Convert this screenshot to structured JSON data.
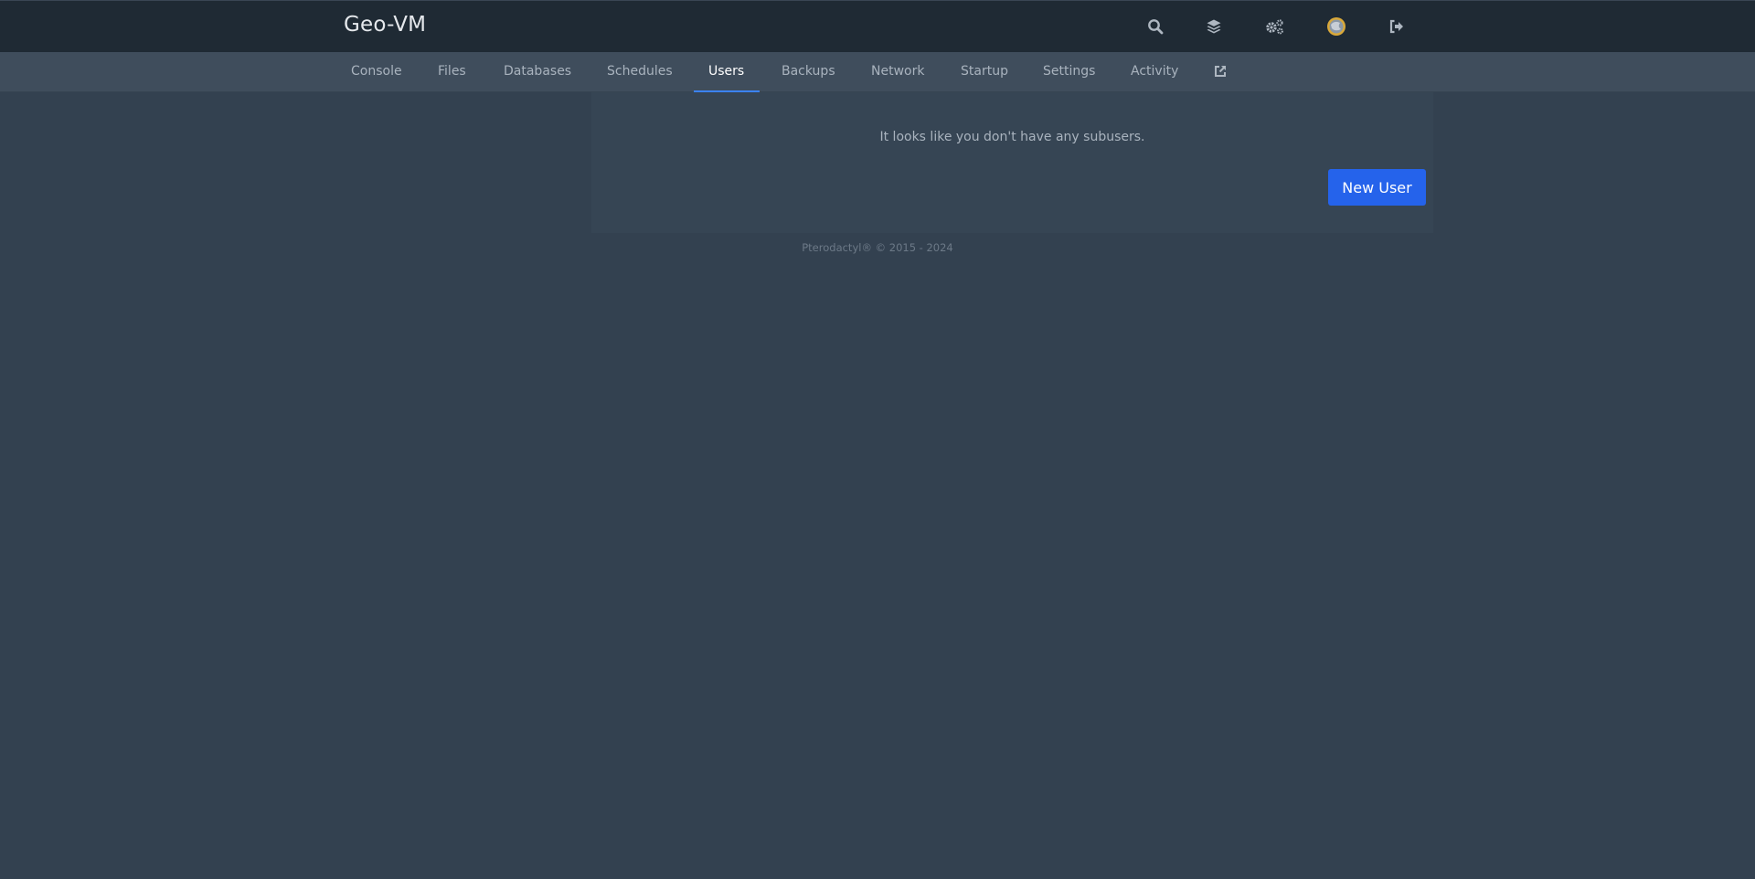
{
  "header": {
    "title": "Geo-VM",
    "icons": [
      {
        "name": "search-icon"
      },
      {
        "name": "layers-icon"
      },
      {
        "name": "cogs-icon"
      },
      {
        "name": "avatar"
      },
      {
        "name": "sign-out-icon"
      }
    ]
  },
  "nav": {
    "tabs": [
      {
        "label": "Console"
      },
      {
        "label": "Files"
      },
      {
        "label": "Databases"
      },
      {
        "label": "Schedules"
      },
      {
        "label": "Users"
      },
      {
        "label": "Backups"
      },
      {
        "label": "Network"
      },
      {
        "label": "Startup"
      },
      {
        "label": "Settings"
      },
      {
        "label": "Activity"
      }
    ],
    "active_tab": "Users",
    "external_icon": "external-link-icon"
  },
  "main": {
    "empty_message": "It looks like you don't have any subusers.",
    "new_user_label": "New User"
  },
  "footer": {
    "text": "Pterodactyl® © 2015 - 2024"
  },
  "colors": {
    "accent": "#3b82f6",
    "button": "#2563eb",
    "topbar": "#1f2a34",
    "subnav": "#3f4d5c",
    "background": "#334150"
  }
}
